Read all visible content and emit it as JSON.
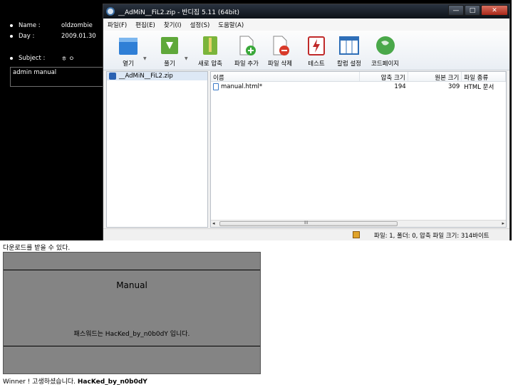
{
  "board": {
    "rows": [
      {
        "label": "Name :",
        "value": "oldzombie"
      },
      {
        "label": "Day :",
        "value": "2009.01.30"
      },
      {
        "label": "Subject :",
        "value": "ㅎ ㅇ"
      }
    ],
    "subject_text": "admin manual"
  },
  "window": {
    "title": "__AdMiN__FiL2.zip - 반디집 5.11 (64bit)",
    "controls": {
      "minimize": "—",
      "maximize": "□",
      "close": "✕"
    },
    "menu": [
      "파일(F)",
      "편집(E)",
      "찾기(I)",
      "설정(S)",
      "도움말(A)"
    ],
    "toolbar": [
      {
        "label": "열기",
        "icon": "open-folder-icon",
        "color": "#2f7fd6"
      },
      {
        "label": "풀기",
        "icon": "extract-icon",
        "color": "#5fa83a"
      },
      {
        "label": "새로 압축",
        "icon": "new-archive-icon",
        "color": "#7bb53b"
      },
      {
        "label": "파일 추가",
        "icon": "add-file-icon",
        "color": "#3aa83a"
      },
      {
        "label": "파일 삭제",
        "icon": "delete-file-icon",
        "color": "#d83a2a"
      },
      {
        "label": "테스트",
        "icon": "test-icon",
        "color": "#c02a2a"
      },
      {
        "label": "칼럼 설정",
        "icon": "column-settings-icon",
        "color": "#2f6fb8"
      },
      {
        "label": "코드페이지",
        "icon": "codepage-globe-icon",
        "color": "#4aa84a"
      }
    ],
    "tree_item": "__AdMiN__FiL2.zip",
    "columns": {
      "name": "이름",
      "compressed": "압축 크기",
      "original": "원본 크기",
      "type": "파일 종류"
    },
    "files": [
      {
        "name": "manual.html*",
        "compressed": "194",
        "original": "309",
        "type": "HTML 문서"
      }
    ],
    "scroll_grip": "III",
    "status": "파일: 1, 폴더: 0, 압축 파일 크기: 314바이트"
  },
  "caption_download": "다운로드를 받을 수 있다.",
  "manual": {
    "title": "Manual",
    "text": "패스워드는 HacKed_by_n0b0dY 입니다."
  },
  "caption_winner": "Winner ! 고생하셨습니다.",
  "caption_winner_bold": "HacKed_by_n0b0dY"
}
